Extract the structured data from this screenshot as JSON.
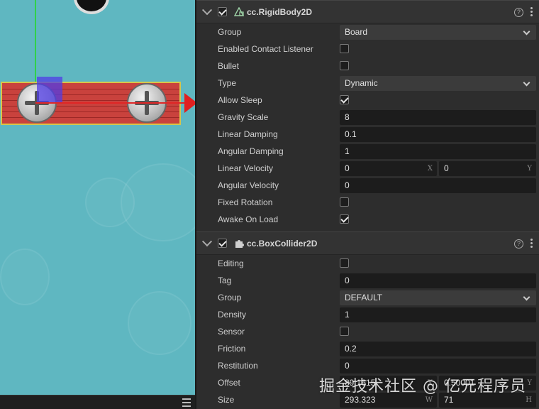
{
  "rigidbody": {
    "title": "cc.RigidBody2D",
    "enabled": true,
    "group": {
      "label": "Group",
      "value": "Board"
    },
    "enabled_contact_listener": {
      "label": "Enabled Contact Listener",
      "checked": false
    },
    "bullet": {
      "label": "Bullet",
      "checked": false
    },
    "type": {
      "label": "Type",
      "value": "Dynamic"
    },
    "allow_sleep": {
      "label": "Allow Sleep",
      "checked": true
    },
    "gravity_scale": {
      "label": "Gravity Scale",
      "value": "8"
    },
    "linear_damping": {
      "label": "Linear Damping",
      "value": "0.1"
    },
    "angular_damping": {
      "label": "Angular Damping",
      "value": "1"
    },
    "linear_velocity": {
      "label": "Linear Velocity",
      "x": "0",
      "y": "0",
      "x_axis": "X",
      "y_axis": "Y"
    },
    "angular_velocity": {
      "label": "Angular Velocity",
      "value": "0"
    },
    "fixed_rotation": {
      "label": "Fixed Rotation",
      "checked": false
    },
    "awake_on_load": {
      "label": "Awake On Load",
      "checked": true
    }
  },
  "boxcollider": {
    "title": "cc.BoxCollider2D",
    "enabled": true,
    "editing": {
      "label": "Editing",
      "checked": false
    },
    "tag": {
      "label": "Tag",
      "value": "0"
    },
    "group": {
      "label": "Group",
      "value": "DEFAULT"
    },
    "density": {
      "label": "Density",
      "value": "1"
    },
    "sensor": {
      "label": "Sensor",
      "checked": false
    },
    "friction": {
      "label": "Friction",
      "value": "0.2"
    },
    "restitution": {
      "label": "Restitution",
      "value": "0"
    },
    "offset": {
      "label": "Offset",
      "x": "89.1615",
      "y": "0.50001",
      "x_axis": "X",
      "y_axis": "Y"
    },
    "size": {
      "label": "Size",
      "w": "293.323",
      "h": "71",
      "w_axis": "W",
      "h_axis": "H"
    }
  },
  "help_glyph": "?",
  "watermark": "掘金技术社区 @ 亿元程序员",
  "colors": {
    "scene_bg": "#5fb7c1",
    "panel_bg": "#2d2d2d",
    "board": "#c9423d",
    "axis_x": "#e02626",
    "axis_y": "#32d04a",
    "gizmo": "#5038e6"
  }
}
